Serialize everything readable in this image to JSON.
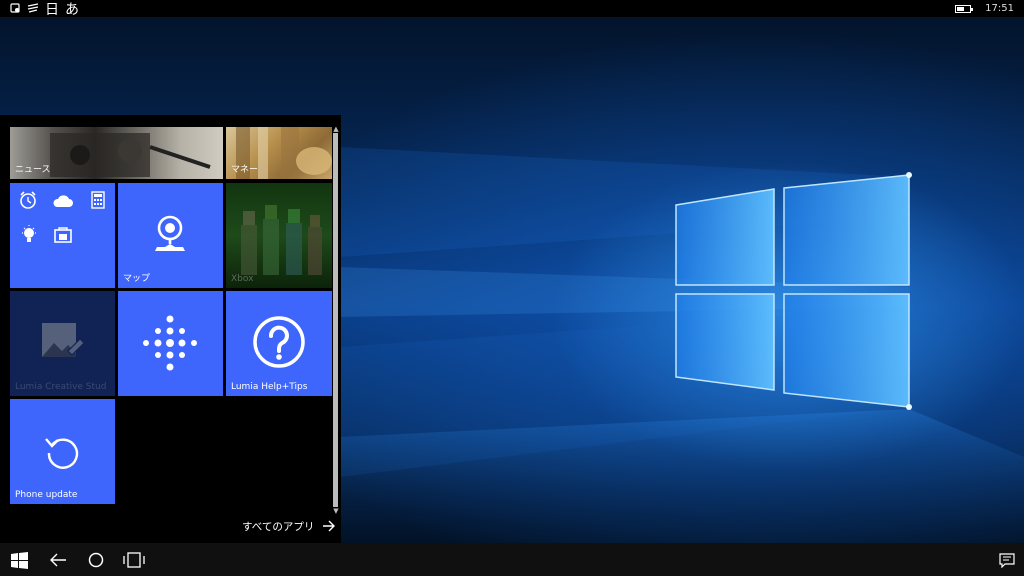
{
  "status_bar": {
    "lang_day": "日",
    "lang_kana": "あ",
    "clock": "17:51",
    "battery_level": 0.55
  },
  "start": {
    "tiles": {
      "news_label": "ニュース",
      "money_label": "マネー",
      "maps_label": "マップ",
      "xbox_label": "Xbox",
      "lumia_creative_label": "Lumia Creative Stud",
      "lumia_help_label": "Lumia Help+Tips",
      "phone_update_label": "Phone update"
    },
    "group_icons": [
      "alarm-clock-icon",
      "cloud-icon",
      "calculator-icon",
      "lightbulb-icon",
      "store-icon"
    ],
    "all_apps_label": "すべてのアプリ"
  },
  "taskbar": {
    "buttons": [
      "windows-logo-icon",
      "back-arrow-icon",
      "search-circle-icon",
      "task-view-icon",
      "action-center-icon"
    ]
  },
  "colors": {
    "tile_blue": "#3e66fd",
    "tile_dim": "#112255",
    "wallpaper_blue": "#0a3d86"
  }
}
